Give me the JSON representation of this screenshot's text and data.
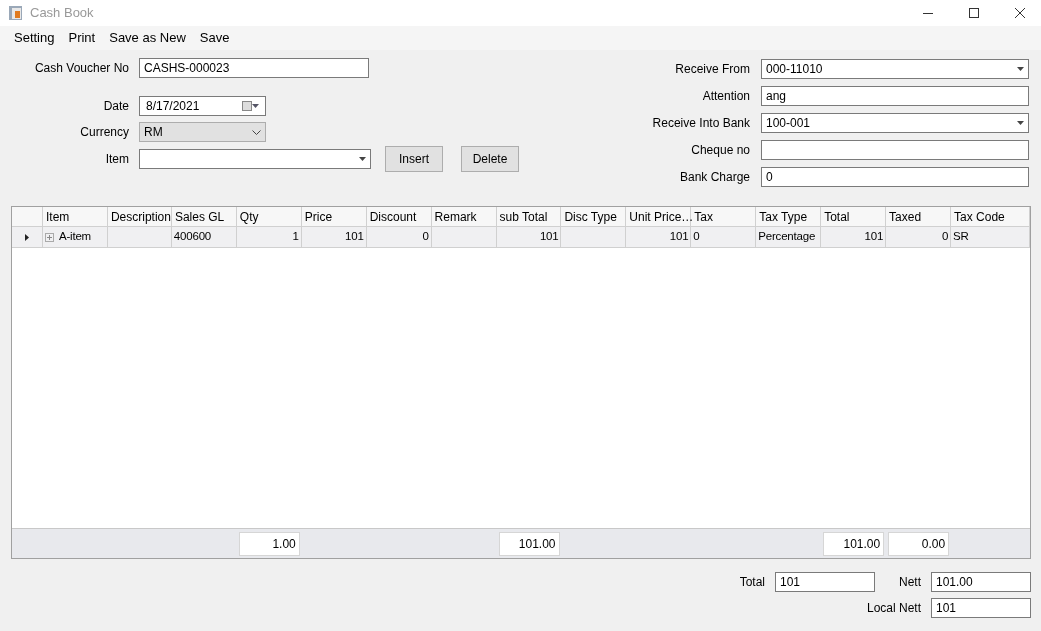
{
  "window": {
    "title": "Cash Book"
  },
  "menu": [
    {
      "label": "Setting"
    },
    {
      "label": "Print"
    },
    {
      "label": "Save as New"
    },
    {
      "label": "Save"
    }
  ],
  "left_form": {
    "voucher": {
      "label": "Cash Voucher No",
      "value": "CASHS-000023"
    },
    "date": {
      "label": "Date",
      "value": "8/17/2021"
    },
    "currency": {
      "label": "Currency",
      "value": "RM",
      "disabled": true
    },
    "item": {
      "label": "Item"
    },
    "buttons": [
      {
        "label": "Insert"
      },
      {
        "label": "Delete"
      }
    ]
  },
  "right_form": [
    {
      "kind": "combo",
      "label": "Receive From",
      "value": "000-11010"
    },
    {
      "kind": "text",
      "label": "Attention",
      "value": "ang"
    },
    {
      "kind": "combo",
      "label": "Receive Into Bank",
      "value": "100-001"
    },
    {
      "kind": "text",
      "label": "Cheque no"
    },
    {
      "kind": "text",
      "label": "Bank Charge",
      "value": "0"
    }
  ],
  "grid": {
    "columns": [
      {
        "label": "Item",
        "kind": "text"
      },
      {
        "label": "Description",
        "kind": "text"
      },
      {
        "label": "Sales GL",
        "kind": "text"
      },
      {
        "label": "Qty",
        "kind": "number",
        "summary": "1.00"
      },
      {
        "label": "Price",
        "kind": "number"
      },
      {
        "label": "Discount",
        "kind": "number"
      },
      {
        "label": "Remark",
        "kind": "text"
      },
      {
        "label": "sub Total",
        "kind": "number",
        "summary": "101.00"
      },
      {
        "label": "Disc Type",
        "kind": "text"
      },
      {
        "label": "Unit Price…",
        "kind": "number"
      },
      {
        "label": "Tax",
        "kind": "text"
      },
      {
        "label": "Tax Type",
        "kind": "text"
      },
      {
        "label": "Total",
        "kind": "number",
        "summary": "101.00"
      },
      {
        "label": "Taxed",
        "kind": "number",
        "summary": "0.00"
      },
      {
        "label": "Tax Code",
        "kind": "text"
      }
    ],
    "rows": [
      {
        "current": true,
        "expanded": false,
        "cells": [
          "A-item",
          null,
          "400600",
          "1",
          "101",
          "0",
          null,
          "101",
          null,
          "101",
          "0",
          "Percentage",
          "101",
          "0",
          "SR"
        ]
      }
    ]
  },
  "totals": {
    "total": {
      "label": "Total",
      "value": "101"
    },
    "nett": {
      "label": "Nett",
      "value": "101.00"
    },
    "local_nett": {
      "label": "Local Nett",
      "value": "101"
    }
  }
}
